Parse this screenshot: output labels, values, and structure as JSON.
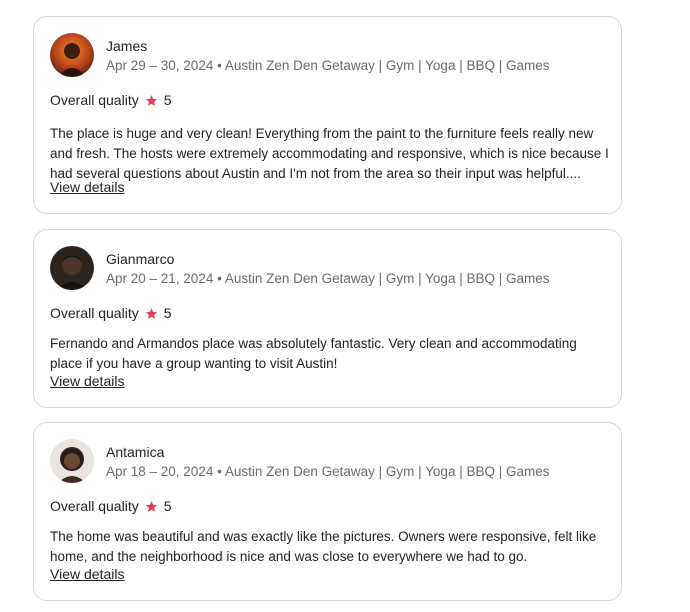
{
  "reviews": [
    {
      "name": "James",
      "stay": "Apr 29 – 30, 2024 • Austin Zen Den Getaway | Gym | Yoga | BBQ | Games",
      "rating_label": "Overall quality",
      "rating_value": "5",
      "text": "The place is huge and very clean! Everything from the paint to the furniture feels really new and fresh. The hosts were extremely accommodating and responsive, which is nice because I had several questions about Austin and I'm not from the area so their input was helpful....",
      "link": "View details"
    },
    {
      "name": "Gianmarco",
      "stay": "Apr 20 – 21, 2024 • Austin Zen Den Getaway | Gym | Yoga | BBQ | Games",
      "rating_label": "Overall quality",
      "rating_value": "5",
      "text": "Fernando and Armandos place was absolutely fantastic. Very clean and accommodating place if you have a group wanting to visit Austin!",
      "link": "View details"
    },
    {
      "name": "Antamica",
      "stay": "Apr 18 – 20, 2024 • Austin Zen Den Getaway | Gym | Yoga | BBQ | Games",
      "rating_label": "Overall quality",
      "rating_value": "5",
      "text": "The home was beautiful and was exactly like the pictures. Owners were responsive, felt like home, and the neighborhood is nice and was close to everywhere we had to go.",
      "link": "View details"
    }
  ],
  "colors": {
    "star": "#e0405e",
    "border": "#d6d6d6",
    "muted_text": "#6a6a6a"
  },
  "icons": {
    "rating": "star-icon"
  }
}
